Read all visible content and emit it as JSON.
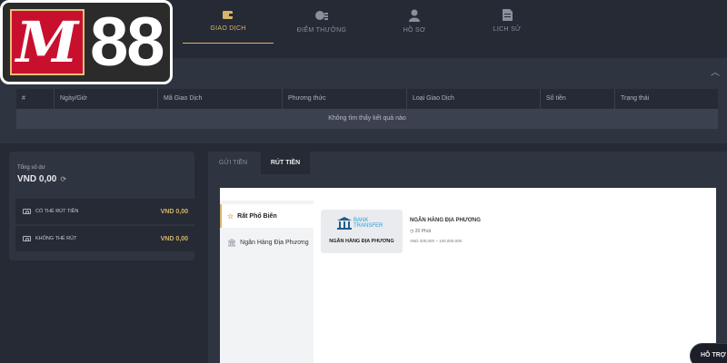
{
  "logo": {
    "letter": "M",
    "number": "88"
  },
  "nav": {
    "tabs": [
      {
        "label": "GIAO DỊCH",
        "icon": "wallet-icon",
        "active": true
      },
      {
        "label": "ĐIỂM THƯỞNG",
        "icon": "coins-icon",
        "active": false
      },
      {
        "label": "HỒ SƠ",
        "icon": "user-icon",
        "active": false
      },
      {
        "label": "LỊCH SỬ",
        "icon": "document-icon",
        "active": false
      }
    ]
  },
  "history": {
    "columns": [
      "#",
      "Ngày/Giờ",
      "Mã Giao Dịch",
      "Phương thức",
      "Loại Giao Dịch",
      "Số tiền",
      "Trạng thái"
    ],
    "empty_message": "Không tìm thấy kết quả nào"
  },
  "balance": {
    "label": "Tổng số dư",
    "total": "VND 0,00",
    "rows": [
      {
        "label": "CÓ THỂ RÚT TIỀN",
        "amount": "VND 0,00"
      },
      {
        "label": "KHÔNG THỂ RÚT",
        "amount": "VND 0,00"
      }
    ]
  },
  "panel": {
    "tabs": [
      {
        "label": "GỬI TIỀN",
        "active": false
      },
      {
        "label": "RÚT TIỀN",
        "active": true
      }
    ],
    "methods": [
      {
        "label": "Rất Phổ Biến",
        "icon": "star-icon",
        "active": true
      },
      {
        "label": "Ngân Hàng Địa Phương",
        "icon": "bank-icon",
        "active": false
      }
    ],
    "bank_card": {
      "logo_line1": "BANK",
      "logo_line2": "TRANSFER",
      "caption": "NGÂN HÀNG ĐỊA PHƯƠNG",
      "name": "NGÂN HÀNG ĐỊA PHƯƠNG",
      "time": "20 Phút",
      "range": "VND 200,000 ~ 100,000,000"
    }
  },
  "support": {
    "label": "HỖ TRỢ"
  },
  "colors": {
    "accent": "#d6b46a",
    "background": "#262a35",
    "panel": "#2f3441",
    "logo_red": "#c8102e"
  }
}
